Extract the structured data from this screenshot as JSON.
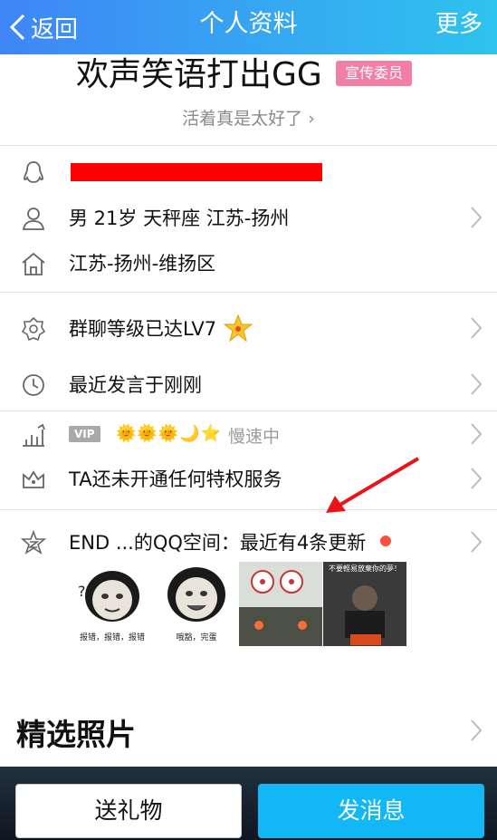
{
  "nav": {
    "back_label": "返回",
    "title": "个人资料",
    "more_label": "更多"
  },
  "profile": {
    "nickname": "欢声笑语打出GG",
    "badge": "宣传委员",
    "signature": "活着真是太好了 ›"
  },
  "info": {
    "basic": "男  21岁  天秤座  江苏-扬州",
    "hometown": "江苏-扬州-维扬区"
  },
  "group": {
    "level_text": "群聊等级已达LV7"
  },
  "activity": {
    "last_speak": "最近发言于刚刚"
  },
  "vip": {
    "badge": "VIP",
    "level_icons": "🌞🌞🌞🌙⭐",
    "speed": "慢速中"
  },
  "privilege": {
    "text": "TA还未开通任何特权服务"
  },
  "qzone": {
    "text": "END  ...的QQ空间：最近有4条更新",
    "thumbs": [
      {
        "caption": "报错，报错，报错"
      },
      {
        "caption": "哦豁，完蛋"
      },
      {
        "caption": ""
      },
      {
        "caption": "不要輕易放棄你的夢！"
      }
    ]
  },
  "featured": {
    "title": "精选照片"
  },
  "actions": {
    "gift_label": "送礼物",
    "message_label": "发消息"
  },
  "colors": {
    "nav_start": "#3f86f6",
    "nav_end": "#2ec3ee",
    "badge": "#f27ea6",
    "message_button": "#12b7f5",
    "arrow": "#e8141a"
  }
}
